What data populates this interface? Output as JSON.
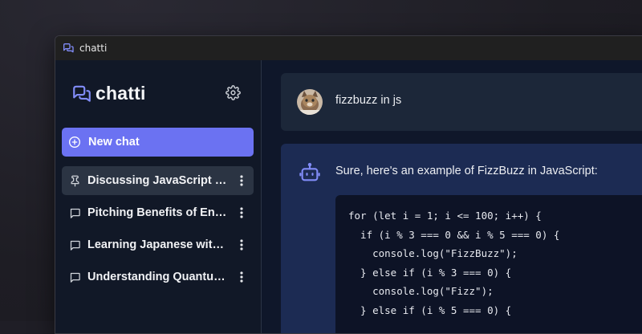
{
  "window": {
    "title": "chatti"
  },
  "sidebar": {
    "brand": "chatti",
    "new_chat_label": "New chat",
    "items": [
      {
        "label": "Discussing JavaScript and Coding",
        "icon": "pin-icon",
        "active": true
      },
      {
        "label": "Pitching Benefits of Energy Efficiency",
        "icon": "message-icon",
        "active": false
      },
      {
        "label": "Learning Japanese with AI Tutor",
        "icon": "message-icon",
        "active": false
      },
      {
        "label": "Understanding Quantum Computing",
        "icon": "message-icon",
        "active": false
      }
    ]
  },
  "conversation": {
    "user_message": "fizzbuzz in js",
    "assistant_intro": "Sure, here's an example of FizzBuzz in JavaScript:",
    "code_lines": [
      "for (let i = 1; i <= 100; i++) {",
      "  if (i % 3 === 0 && i % 5 === 0) {",
      "    console.log(\"FizzBuzz\");",
      "  } else if (i % 3 === 0) {",
      "    console.log(\"Fizz\");",
      "  } else if (i % 5 === 0) {"
    ]
  },
  "colors": {
    "accent": "#6b72f2",
    "icon_accent": "#818cf8",
    "sidebar_bg": "#111827",
    "active_item_bg": "#2b3443",
    "assistant_bg": "#1c2b53",
    "code_bg": "#0d1326"
  }
}
